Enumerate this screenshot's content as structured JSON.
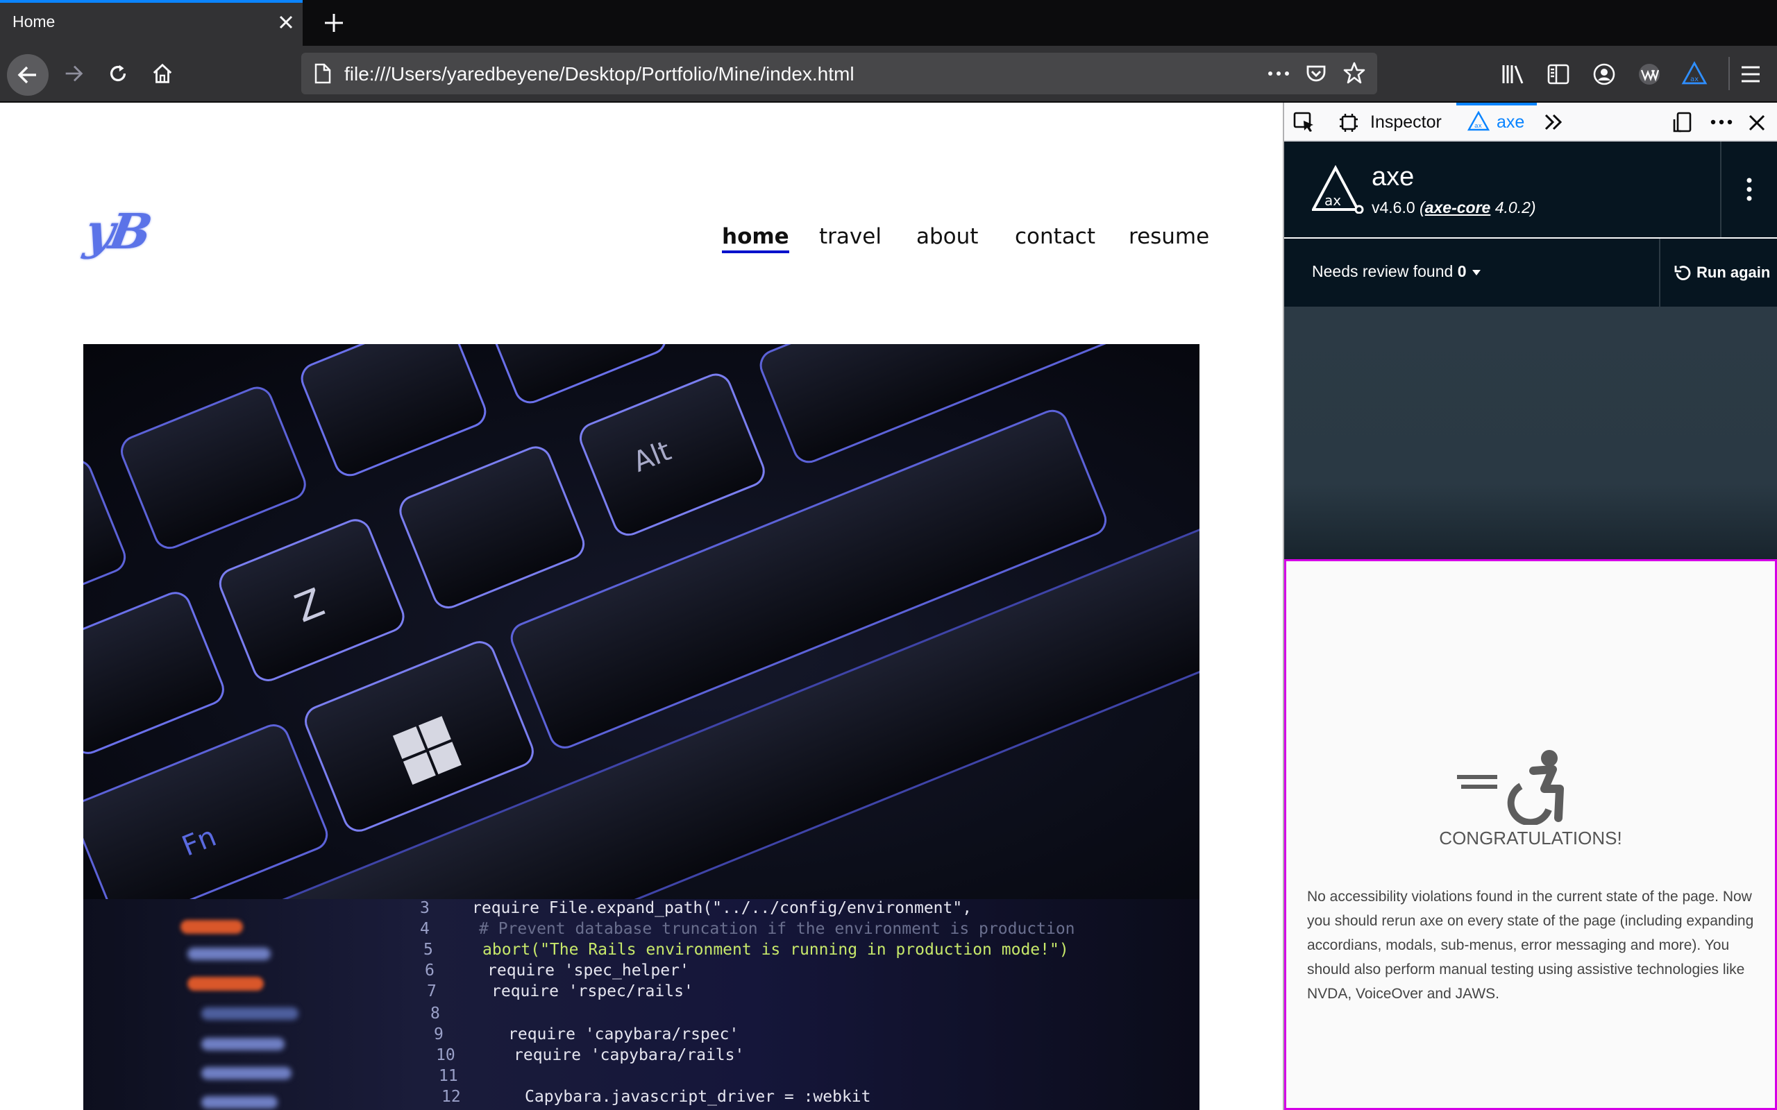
{
  "browser": {
    "tab_title": "Home",
    "url": "file:///Users/yaredbeyene/Desktop/Portfolio/Mine/index.html"
  },
  "site": {
    "logo": "yB",
    "nav": [
      {
        "label": "home",
        "active": true
      },
      {
        "label": "travel"
      },
      {
        "label": "about"
      },
      {
        "label": "contact"
      },
      {
        "label": "resume"
      }
    ],
    "code_lines": [
      {
        "num": "3",
        "text": "require File.expand_path(\"../../config/environment\","
      },
      {
        "num": "4",
        "text": "# Prevent database truncation if the environment is production"
      },
      {
        "num": "5",
        "text": "abort(\"The Rails environment is running in production mode!\")"
      },
      {
        "num": "6",
        "text": "require 'spec_helper'"
      },
      {
        "num": "7",
        "text": "require 'rspec/rails'"
      },
      {
        "num": "8",
        "text": ""
      },
      {
        "num": "9",
        "text": "require 'capybara/rspec'"
      },
      {
        "num": "10",
        "text": "require 'capybara/rails'"
      },
      {
        "num": "11",
        "text": ""
      },
      {
        "num": "12",
        "text": "Capybara.javascript_driver = :webkit"
      }
    ]
  },
  "devtools": {
    "inspector_label": "Inspector",
    "axe_tab_label": "axe",
    "axe": {
      "title": "axe",
      "version": "v4.6.0",
      "core_link": "axe-core",
      "core_version": "4.0.2",
      "review_label": "Needs review found",
      "review_count": "0",
      "run_again": "Run again",
      "congrats_title": "CONGRATULATIONS!",
      "congrats_text": "No accessibility violations found in the current state of the page. Now you should rerun axe on every state of the page (including expanding accordians, modals, sub-menus, error messaging and more). You should also perform manual testing using assistive technologies like NVDA, VoiceOver and JAWS."
    }
  },
  "colors": {
    "accent": "#0a84ff",
    "nav_underline": "#0011cc",
    "axe_dark": "#061520",
    "highlight_border": "#d400e6"
  }
}
